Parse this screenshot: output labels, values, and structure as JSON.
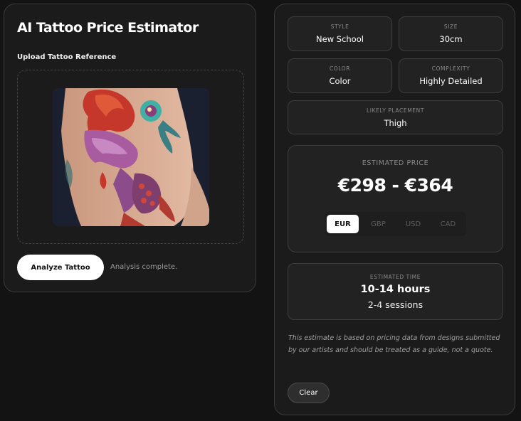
{
  "left": {
    "title": "AI Tattoo Price Estimator",
    "upload_label": "Upload Tattoo Reference",
    "analyze_button": "Analyze Tattoo",
    "status": "Analysis complete."
  },
  "attributes": {
    "style": {
      "label": "STYLE",
      "value": "New School"
    },
    "size": {
      "label": "SIZE",
      "value": "30cm"
    },
    "color": {
      "label": "COLOR",
      "value": "Color"
    },
    "complexity": {
      "label": "COMPLEXITY",
      "value": "Highly Detailed"
    },
    "placement": {
      "label": "LIKELY PLACEMENT",
      "value": "Thigh"
    }
  },
  "price": {
    "label": "ESTIMATED PRICE",
    "value": "€298 - €364",
    "currencies": [
      "EUR",
      "GBP",
      "USD",
      "CAD"
    ],
    "selected_currency": "EUR"
  },
  "time": {
    "label": "ESTIMATED TIME",
    "hours": "10-14 hours",
    "sessions": "2-4 sessions"
  },
  "disclaimer": "This estimate is based on pricing data from designs submitted by our artists and should be treated as a guide, not a quote.",
  "clear_button": "Clear",
  "colors": {
    "background": "#131313",
    "panel": "#1b1b1b",
    "card": "#222222",
    "accent": "#ffffff"
  }
}
